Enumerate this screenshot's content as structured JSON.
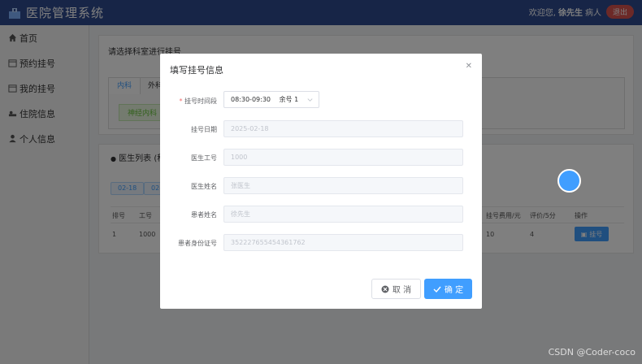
{
  "header": {
    "app_title": "医院管理系统",
    "welcome": "欢迎您,",
    "user_name": "徐先生",
    "role": "病人",
    "logout_label": "退出"
  },
  "sidebar": {
    "items": [
      {
        "label": "首页",
        "icon": "home-icon"
      },
      {
        "label": "预约挂号",
        "icon": "calendar-icon"
      },
      {
        "label": "我的挂号",
        "icon": "calendar-icon"
      },
      {
        "label": "住院信息",
        "icon": "bed-icon"
      },
      {
        "label": "个人信息",
        "icon": "user-icon"
      }
    ]
  },
  "main": {
    "select_dept_title": "请选择科室进行挂号",
    "tabs": [
      {
        "label": "内科",
        "active": true
      },
      {
        "label": "外科",
        "active": false
      }
    ],
    "subdept": "神经内科",
    "doctor_list_title": "医生列表 (科",
    "date_tags": [
      "02-18",
      "02-"
    ],
    "table_headers": {
      "index": "排号",
      "id": "工号",
      "fee": "挂号费用/元",
      "rating": "评价/5分",
      "action": "操作"
    },
    "table_row": {
      "index": "1",
      "id": "1000",
      "fee": "10",
      "rating": "4"
    },
    "register_btn": "挂号"
  },
  "modal": {
    "title": "填写挂号信息",
    "fields": {
      "time_slot_label": "挂号时间段",
      "time_slot_value": "08:30-09:30",
      "remaining": "余号 1",
      "date_label": "挂号日期",
      "date_value": "2025-02-18",
      "doctor_id_label": "医生工号",
      "doctor_id_value": "1000",
      "doctor_name_label": "医生姓名",
      "doctor_name_value": "张医生",
      "patient_name_label": "患者姓名",
      "patient_name_value": "徐先生",
      "patient_id_label": "患者身份证号",
      "patient_id_value": "352227655454361762"
    },
    "cancel_label": "取 消",
    "ok_label": "确 定"
  },
  "watermark": "CSDN @Coder-coco",
  "colors": {
    "primary": "#409eff",
    "header": "#2f4b8f",
    "danger": "#d9534f"
  }
}
